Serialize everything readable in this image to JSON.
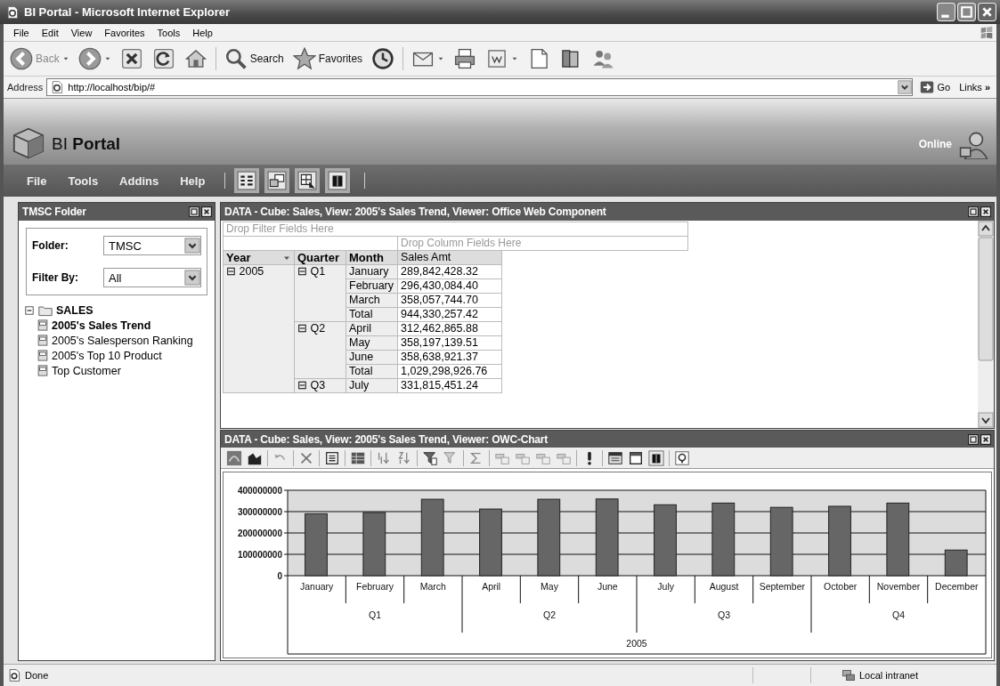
{
  "window": {
    "title": "BI Portal - Microsoft Internet Explorer"
  },
  "menu": [
    "File",
    "Edit",
    "View",
    "Favorites",
    "Tools",
    "Help"
  ],
  "toolbar": {
    "back": "Back",
    "search": "Search",
    "favorites": "Favorites"
  },
  "address": {
    "label": "Address",
    "value": "http://localhost/bip/#",
    "go": "Go",
    "links": "Links",
    "links_more": "»"
  },
  "app": {
    "logo": "BI **Portal**",
    "status": "Online",
    "menu": [
      "File",
      "Tools",
      "Addins",
      "Help"
    ]
  },
  "folder_panel": {
    "title": "TMSC Folder",
    "fields": [
      {
        "label": "Folder:",
        "value": "TMSC"
      },
      {
        "label": "Filter By:",
        "value": "All"
      }
    ],
    "tree": [
      {
        "label": "SALES",
        "expanded": true,
        "children": [
          {
            "label": "2005's Sales Trend",
            "selected": true
          },
          {
            "label": "2005's Salesperson Ranking",
            "selected": false
          },
          {
            "label": "2005's Top 10 Product",
            "selected": false
          },
          {
            "label": "Top Customer",
            "selected": false
          }
        ]
      }
    ]
  },
  "pivot_panel": {
    "title": "DATA - Cube: Sales, View: 2005's Sales Trend, Viewer: Office Web Component",
    "filter_drop_zone": "Drop Filter Fields Here",
    "column_drop_zone": "Drop Column Fields Here",
    "headers": [
      "Year",
      "Quarter",
      "Month",
      "Sales Amt"
    ],
    "years": [
      {
        "label": "⊟ 2005",
        "quarters": [
          {
            "label": "⊟ Q1",
            "rows": [
              {
                "month": "January",
                "value": "289,842,428.32"
              },
              {
                "month": "February",
                "value": "296,430,084.40"
              },
              {
                "month": "March",
                "value": "358,057,744.70"
              },
              {
                "month": "Total",
                "value": "944,330,257.42"
              }
            ]
          },
          {
            "label": "⊟ Q2",
            "rows": [
              {
                "month": "April",
                "value": "312,462,865.88"
              },
              {
                "month": "May",
                "value": "358,197,139.51"
              },
              {
                "month": "June",
                "value": "358,638,921.37"
              },
              {
                "month": "Total",
                "value": "1,029,298,926.76"
              }
            ]
          },
          {
            "label": "⊟ Q3",
            "rows": [
              {
                "month": "July",
                "value": "331,815,451.24"
              }
            ]
          }
        ]
      }
    ]
  },
  "chart_panel": {
    "title": "DATA - Cube: Sales, View: 2005's Sales Trend, Viewer: OWC-Chart",
    "chart_data": {
      "type": "bar",
      "categories": [
        "January",
        "February",
        "March",
        "April",
        "May",
        "June",
        "July",
        "August",
        "September",
        "October",
        "November",
        "December"
      ],
      "series": [
        {
          "color": "#666666",
          "values": [
            290000000,
            296000000,
            358000000,
            312000000,
            358000000,
            359000000,
            332000000,
            340000000,
            320000000,
            325000000,
            340000000,
            120000000
          ]
        }
      ],
      "grid": true,
      "ylim": [
        0,
        400000000
      ],
      "yticks": [
        0,
        100000000,
        200000000,
        300000000,
        400000000
      ]
    },
    "axis_groups": [
      "Q1",
      "Q2",
      "Q3",
      "Q4"
    ],
    "axis_super": "2005"
  },
  "status_bar": {
    "text": "Done",
    "zone": "Local intranet"
  }
}
